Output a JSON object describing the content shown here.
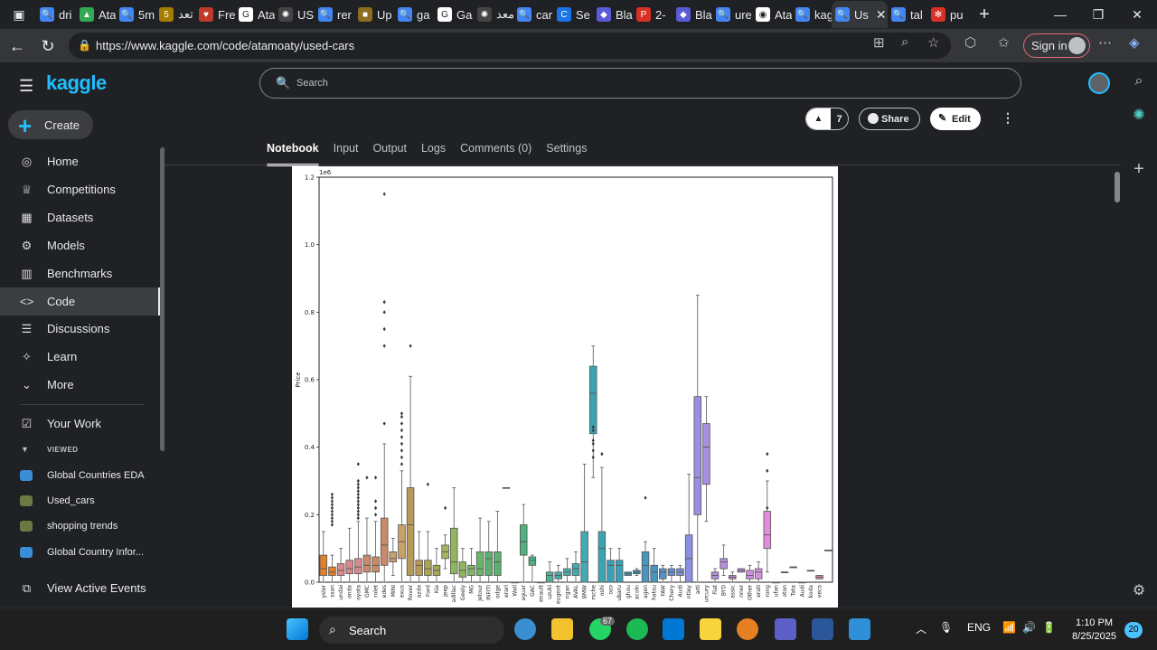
{
  "browser": {
    "tabs": [
      {
        "label": "dri",
        "fav_color": "#4285f4",
        "fav": "🔍"
      },
      {
        "label": "Ata",
        "fav_color": "#34a853",
        "fav": "▲"
      },
      {
        "label": "5m",
        "fav_color": "#4285f4",
        "fav": "🔍"
      },
      {
        "label": "تعد",
        "fav_color": "#a67c00",
        "fav": "5"
      },
      {
        "label": "Fre",
        "fav_color": "#c0392b",
        "fav": "♥"
      },
      {
        "label": "Ata",
        "fav_color": "#ffffff",
        "fav": "G"
      },
      {
        "label": "US",
        "fav_color": "#444",
        "fav": "✺"
      },
      {
        "label": "rer",
        "fav_color": "#4285f4",
        "fav": "🔍"
      },
      {
        "label": "Up",
        "fav_color": "#8a6d1e",
        "fav": "■"
      },
      {
        "label": "ga",
        "fav_color": "#4285f4",
        "fav": "🔍"
      },
      {
        "label": "Ga",
        "fav_color": "#ffffff",
        "fav": "G"
      },
      {
        "label": "معد",
        "fav_color": "#444",
        "fav": "✺"
      },
      {
        "label": "car",
        "fav_color": "#4285f4",
        "fav": "🔍"
      },
      {
        "label": "Se",
        "fav_color": "#1a73e8",
        "fav": "C"
      },
      {
        "label": "Bla",
        "fav_color": "#5b5bd6",
        "fav": "◆"
      },
      {
        "label": "2-",
        "fav_color": "#d93025",
        "fav": "P"
      },
      {
        "label": "Bla",
        "fav_color": "#5b5bd6",
        "fav": "◆"
      },
      {
        "label": "ure",
        "fav_color": "#4285f4",
        "fav": "🔍"
      },
      {
        "label": "Ata",
        "fav_color": "#ffffff",
        "fav": "◉"
      },
      {
        "label": "kag",
        "fav_color": "#4285f4",
        "fav": "🔍"
      },
      {
        "label": "Us",
        "fav_color": "#4285f4",
        "fav": "🔍",
        "active": true
      },
      {
        "label": "tal",
        "fav_color": "#4285f4",
        "fav": "🔍"
      },
      {
        "label": "pu",
        "fav_color": "#d93025",
        "fav": "✻"
      }
    ],
    "url": "https://www.kaggle.com/code/atamoaty/used-cars",
    "signin_label": "Sign in"
  },
  "kaggle": {
    "logo": "kaggle",
    "create_label": "Create",
    "search_placeholder": "Search",
    "nav": [
      {
        "label": "Home",
        "icon": "home-icon",
        "glyph": "◎"
      },
      {
        "label": "Competitions",
        "icon": "trophy-icon",
        "glyph": "♕"
      },
      {
        "label": "Datasets",
        "icon": "table-icon",
        "glyph": "▦"
      },
      {
        "label": "Models",
        "icon": "models-icon",
        "glyph": "⚙"
      },
      {
        "label": "Benchmarks",
        "icon": "benchmark-icon",
        "glyph": "▥"
      },
      {
        "label": "Code",
        "icon": "code-icon",
        "glyph": "<>",
        "active": true
      },
      {
        "label": "Discussions",
        "icon": "discussion-icon",
        "glyph": "☰"
      },
      {
        "label": "Learn",
        "icon": "learn-icon",
        "glyph": "✧"
      },
      {
        "label": "More",
        "icon": "chevron-down-icon",
        "glyph": "⌄"
      }
    ],
    "your_work": "Your Work",
    "viewed_label": "VIEWED",
    "recent": [
      {
        "label": "Global Countries EDA",
        "color": "#3b8ed6"
      },
      {
        "label": "Used_cars",
        "color": "#6b7a45"
      },
      {
        "label": "shopping trends",
        "color": "#6b7a45"
      },
      {
        "label": "Global Country Infor...",
        "color": "#3b8ed6"
      }
    ],
    "view_active_events": "View Active Events",
    "vote_count": "7",
    "share_label": "Share",
    "edit_label": "Edit",
    "tabs": [
      "Notebook",
      "Input",
      "Output",
      "Logs",
      "Comments (0)",
      "Settings"
    ],
    "active_tab": "Notebook"
  },
  "taskbar": {
    "search_label": "Search",
    "lang": "ENG",
    "time": "1:10 PM",
    "date": "8/25/2025",
    "notif_count": "20",
    "badge_whatsapp": "67"
  },
  "chart_data": {
    "type": "boxplot",
    "ylabel": "Price",
    "y_multiplier": "1e6",
    "ylim": [
      0,
      1.2
    ],
    "yticks": [
      "0.0",
      "0.2",
      "0.4",
      "0.6",
      "0.8",
      "1.0",
      "1.2"
    ],
    "categories": [
      "ysler",
      "ssan",
      "undai",
      "onda",
      "oyota",
      "GMC",
      "rolet",
      "edes",
      "MINI",
      "exus",
      "Rover",
      "azda",
      "Ford",
      "Kia",
      "jeep",
      "adillac",
      "Geely",
      "MG",
      "Jetour",
      "INFITI",
      "odge",
      "erari",
      "Wall",
      "aguar",
      "GAC",
      "enault",
      "uzuki",
      "eugeot",
      "ngan",
      "AVAL",
      "BMW",
      "rsche",
      "oshi",
      "ozo",
      "ubaru",
      "ghou",
      "acoln",
      "agen",
      "hatsu",
      "FAW",
      "Chery",
      "Audi",
      "ntley",
      "arti",
      "urcury",
      "Fiat",
      "BYD",
      "assic",
      "nner",
      "Other",
      "erati",
      "rong",
      "ufan",
      "oton",
      "Tata",
      "Audi",
      "koda",
      "veco"
    ],
    "boxes": [
      {
        "q1": 0.02,
        "med": 0.04,
        "q3": 0.08,
        "lo": 0.0,
        "hi": 0.15,
        "color": "#e1812c"
      },
      {
        "q1": 0.02,
        "med": 0.03,
        "q3": 0.045,
        "lo": 0.0,
        "hi": 0.08,
        "color": "#e1812c"
      },
      {
        "q1": 0.02,
        "med": 0.035,
        "q3": 0.055,
        "lo": 0.0,
        "hi": 0.1,
        "color": "#d88a8a"
      },
      {
        "q1": 0.025,
        "med": 0.04,
        "q3": 0.065,
        "lo": 0.0,
        "hi": 0.16,
        "color": "#d88a8a"
      },
      {
        "q1": 0.025,
        "med": 0.045,
        "q3": 0.07,
        "lo": 0.0,
        "hi": 0.18,
        "color": "#d88a8a"
      },
      {
        "q1": 0.03,
        "med": 0.05,
        "q3": 0.08,
        "lo": 0.0,
        "hi": 0.19,
        "color": "#c98a6a"
      },
      {
        "q1": 0.03,
        "med": 0.05,
        "q3": 0.075,
        "lo": 0.0,
        "hi": 0.18,
        "color": "#c98a6a"
      },
      {
        "q1": 0.05,
        "med": 0.11,
        "q3": 0.19,
        "lo": 0.0,
        "hi": 0.41,
        "color": "#c98a6a"
      },
      {
        "q1": 0.06,
        "med": 0.07,
        "q3": 0.09,
        "lo": 0.02,
        "hi": 0.13,
        "color": "#c9a06a"
      },
      {
        "q1": 0.07,
        "med": 0.12,
        "q3": 0.17,
        "lo": 0.0,
        "hi": 0.33,
        "color": "#c9a06a"
      },
      {
        "q1": 0.02,
        "med": 0.17,
        "q3": 0.28,
        "lo": 0.0,
        "hi": 0.61,
        "color": "#b79a57"
      },
      {
        "q1": 0.02,
        "med": 0.05,
        "q3": 0.065,
        "lo": 0.0,
        "hi": 0.15,
        "color": "#b79a57"
      },
      {
        "q1": 0.02,
        "med": 0.04,
        "q3": 0.065,
        "lo": 0.0,
        "hi": 0.15,
        "color": "#a9a657"
      },
      {
        "q1": 0.02,
        "med": 0.035,
        "q3": 0.05,
        "lo": 0.0,
        "hi": 0.1,
        "color": "#a9a657"
      },
      {
        "q1": 0.07,
        "med": 0.09,
        "q3": 0.11,
        "lo": 0.04,
        "hi": 0.14,
        "color": "#a2b55f"
      },
      {
        "q1": 0.025,
        "med": 0.06,
        "q3": 0.16,
        "lo": 0.0,
        "hi": 0.28,
        "color": "#8fb55f"
      },
      {
        "q1": 0.015,
        "med": 0.035,
        "q3": 0.06,
        "lo": 0.0,
        "hi": 0.1,
        "color": "#8fb55f"
      },
      {
        "q1": 0.02,
        "med": 0.04,
        "q3": 0.05,
        "lo": 0.0,
        "hi": 0.1,
        "color": "#7db56a"
      },
      {
        "q1": 0.02,
        "med": 0.04,
        "q3": 0.09,
        "lo": 0.0,
        "hi": 0.19,
        "color": "#6bb56a"
      },
      {
        "q1": 0.02,
        "med": 0.07,
        "q3": 0.09,
        "lo": 0.0,
        "hi": 0.18,
        "color": "#5cb070"
      },
      {
        "q1": 0.02,
        "med": 0.06,
        "q3": 0.09,
        "lo": 0.0,
        "hi": 0.21,
        "color": "#5cb070"
      },
      {
        "q1": 0.28,
        "med": 0.28,
        "q3": 0.28,
        "lo": 0.28,
        "hi": 0.28,
        "color": "#5cb070"
      },
      {
        "q1": 0.0,
        "med": 0.0,
        "q3": 0.0,
        "lo": 0.0,
        "hi": 0.0,
        "color": "#5cb070"
      },
      {
        "q1": 0.08,
        "med": 0.12,
        "q3": 0.17,
        "lo": 0.0,
        "hi": 0.23,
        "color": "#4fb080"
      },
      {
        "q1": 0.05,
        "med": 0.065,
        "q3": 0.075,
        "lo": 0.0,
        "hi": 0.08,
        "color": "#4fb080"
      },
      {
        "q1": 0.0,
        "med": 0.0,
        "q3": 0.0,
        "lo": 0.0,
        "hi": 0.0,
        "color": "#4fb090"
      },
      {
        "q1": 0.0,
        "med": 0.02,
        "q3": 0.03,
        "lo": 0.0,
        "hi": 0.06,
        "color": "#4fb090"
      },
      {
        "q1": 0.01,
        "med": 0.02,
        "q3": 0.03,
        "lo": 0.0,
        "hi": 0.05,
        "color": "#4aadaa"
      },
      {
        "q1": 0.02,
        "med": 0.03,
        "q3": 0.04,
        "lo": 0.0,
        "hi": 0.07,
        "color": "#4aadaa"
      },
      {
        "q1": 0.02,
        "med": 0.04,
        "q3": 0.055,
        "lo": 0.0,
        "hi": 0.09,
        "color": "#45a9b0"
      },
      {
        "q1": 0.0,
        "med": 0.06,
        "q3": 0.15,
        "lo": 0.0,
        "hi": 0.35,
        "color": "#45a9b0"
      },
      {
        "q1": 0.44,
        "med": 0.56,
        "q3": 0.64,
        "lo": 0.31,
        "hi": 0.7,
        "color": "#3aa5b0"
      },
      {
        "q1": 0.0,
        "med": 0.1,
        "q3": 0.15,
        "lo": 0.0,
        "hi": 0.34,
        "color": "#3aa5b0"
      },
      {
        "q1": 0.0,
        "med": 0.05,
        "q3": 0.065,
        "lo": 0.0,
        "hi": 0.1,
        "color": "#3aa0b5"
      },
      {
        "q1": 0.0,
        "med": 0.05,
        "q3": 0.065,
        "lo": 0.0,
        "hi": 0.1,
        "color": "#3aa0b5"
      },
      {
        "q1": 0.02,
        "med": 0.025,
        "q3": 0.03,
        "lo": 0.02,
        "hi": 0.03,
        "color": "#3a9ab8"
      },
      {
        "q1": 0.025,
        "med": 0.03,
        "q3": 0.035,
        "lo": 0.02,
        "hi": 0.04,
        "color": "#3a9ab8"
      },
      {
        "q1": 0.0,
        "med": 0.05,
        "q3": 0.09,
        "lo": 0.0,
        "hi": 0.12,
        "color": "#4a95c0"
      },
      {
        "q1": 0.0,
        "med": 0.03,
        "q3": 0.05,
        "lo": 0.0,
        "hi": 0.1,
        "color": "#4a95c0"
      },
      {
        "q1": 0.01,
        "med": 0.03,
        "q3": 0.04,
        "lo": 0.0,
        "hi": 0.05,
        "color": "#5a90c8"
      },
      {
        "q1": 0.02,
        "med": 0.03,
        "q3": 0.04,
        "lo": 0.0,
        "hi": 0.05,
        "color": "#6a8fd0"
      },
      {
        "q1": 0.02,
        "med": 0.03,
        "q3": 0.04,
        "lo": 0.0,
        "hi": 0.05,
        "color": "#7a8fd8"
      },
      {
        "q1": 0.0,
        "med": 0.07,
        "q3": 0.14,
        "lo": 0.0,
        "hi": 0.32,
        "color": "#8a8fe0"
      },
      {
        "q1": 0.2,
        "med": 0.31,
        "q3": 0.55,
        "lo": 0.0,
        "hi": 0.85,
        "color": "#9a8fe0"
      },
      {
        "q1": 0.29,
        "med": 0.4,
        "q3": 0.47,
        "lo": 0.18,
        "hi": 0.55,
        "color": "#a88fe0"
      },
      {
        "q1": 0.01,
        "med": 0.02,
        "q3": 0.03,
        "lo": 0.0,
        "hi": 0.04,
        "color": "#b08fe0"
      },
      {
        "q1": 0.04,
        "med": 0.06,
        "q3": 0.07,
        "lo": 0.02,
        "hi": 0.11,
        "color": "#b88fe0"
      },
      {
        "q1": 0.01,
        "med": 0.015,
        "q3": 0.02,
        "lo": 0.0,
        "hi": 0.03,
        "color": "#c08fe0"
      },
      {
        "q1": 0.03,
        "med": 0.035,
        "q3": 0.04,
        "lo": 0.03,
        "hi": 0.04,
        "color": "#c88fe0"
      },
      {
        "q1": 0.01,
        "med": 0.02,
        "q3": 0.035,
        "lo": 0.0,
        "hi": 0.05,
        "color": "#d08fe0"
      },
      {
        "q1": 0.01,
        "med": 0.03,
        "q3": 0.04,
        "lo": 0.0,
        "hi": 0.06,
        "color": "#d890e0"
      },
      {
        "q1": 0.1,
        "med": 0.14,
        "q3": 0.21,
        "lo": 0.03,
        "hi": 0.3,
        "color": "#e08fd8"
      },
      {
        "q1": 0.0,
        "med": 0.0,
        "q3": 0.0,
        "lo": 0.0,
        "hi": 0.0,
        "color": "#e08fd0"
      },
      {
        "q1": 0.03,
        "med": 0.03,
        "q3": 0.03,
        "lo": 0.03,
        "hi": 0.03,
        "color": "#e08fc8"
      },
      {
        "q1": 0.045,
        "med": 0.045,
        "q3": 0.045,
        "lo": 0.045,
        "hi": 0.045,
        "color": "#e08fc0"
      },
      {
        "q1": 0.0,
        "med": 0.0,
        "q3": 0.0,
        "lo": 0.0,
        "hi": 0.0,
        "color": "#e08fb8"
      },
      {
        "q1": 0.035,
        "med": 0.035,
        "q3": 0.035,
        "lo": 0.035,
        "hi": 0.035,
        "color": "#e08fb0"
      },
      {
        "q1": 0.01,
        "med": 0.015,
        "q3": 0.02,
        "lo": 0.01,
        "hi": 0.02,
        "color": "#e08fa8"
      },
      {
        "q1": 0.095,
        "med": 0.095,
        "q3": 0.095,
        "lo": 0.095,
        "hi": 0.095,
        "color": "#e08fa0"
      }
    ],
    "outliers": [
      {
        "i": 1,
        "ys": [
          0.17,
          0.18,
          0.19,
          0.2,
          0.21,
          0.22,
          0.23,
          0.24,
          0.25,
          0.26
        ]
      },
      {
        "i": 4,
        "ys": [
          0.19,
          0.2,
          0.21,
          0.22,
          0.23,
          0.24,
          0.25,
          0.26,
          0.27,
          0.28,
          0.29,
          0.3,
          0.35
        ]
      },
      {
        "i": 5,
        "ys": [
          0.31
        ]
      },
      {
        "i": 6,
        "ys": [
          0.2,
          0.22,
          0.24,
          0.31
        ]
      },
      {
        "i": 7,
        "ys": [
          0.47,
          0.7,
          0.75,
          0.8,
          0.83,
          1.15
        ]
      },
      {
        "i": 9,
        "ys": [
          0.35,
          0.37,
          0.39,
          0.41,
          0.43,
          0.45,
          0.47,
          0.49,
          0.5
        ]
      },
      {
        "i": 10,
        "ys": [
          0.7
        ]
      },
      {
        "i": 12,
        "ys": [
          0.29
        ]
      },
      {
        "i": 14,
        "ys": [
          0.22
        ]
      },
      {
        "i": 31,
        "ys": [
          0.37,
          0.39,
          0.41,
          0.42,
          0.45,
          0.46
        ]
      },
      {
        "i": 32,
        "ys": [
          0.38
        ]
      },
      {
        "i": 37,
        "ys": [
          0.25
        ]
      },
      {
        "i": 51,
        "ys": [
          0.22,
          0.33,
          0.38
        ]
      }
    ]
  }
}
